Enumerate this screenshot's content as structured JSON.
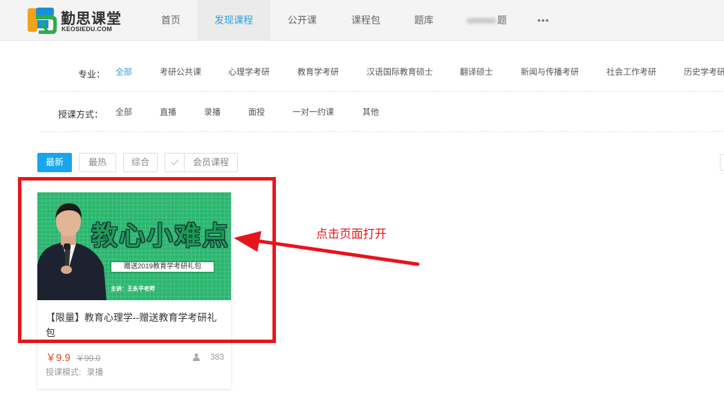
{
  "header": {
    "logo_text": "勤思课堂",
    "logo_sub": "KEOSIEDU.COM",
    "nav": [
      {
        "label": "首页",
        "active": false
      },
      {
        "label": "发现课程",
        "active": true
      },
      {
        "label": "公开课",
        "active": false
      },
      {
        "label": "课程包",
        "active": false
      },
      {
        "label": "题库",
        "active": false
      },
      {
        "label": "题",
        "active": false,
        "blurred": true
      }
    ],
    "more": "•••"
  },
  "filters": {
    "major": {
      "label": "专业：",
      "items": [
        "全部",
        "考研公共课",
        "心理学考研",
        "教育学考研",
        "汉语国际教育硕士",
        "翻译硕士",
        "新闻与传播考研",
        "社会工作考研",
        "历史学考研"
      ],
      "selected": 0
    },
    "mode": {
      "label": "授课方式：",
      "items": [
        "全部",
        "直播",
        "录播",
        "面授",
        "一对一约课",
        "其他"
      ],
      "selected": -1
    }
  },
  "sort_tabs": {
    "items": [
      "最新",
      "最热",
      "综合"
    ],
    "selected": 0,
    "member_label": "会员课程"
  },
  "course": {
    "thumb": {
      "title": "教心小难点",
      "banner": "赠送2019教育学考研礼包",
      "lecturer": "主讲：王永平老师"
    },
    "title": "【限量】教育心理学--赠送教育学考研礼包",
    "price": "￥9.9",
    "price_old": "￥99.0",
    "learners": "383",
    "mode_label": "授课模式:",
    "mode_value": "录播"
  },
  "annotation": {
    "text": "点击页面打开",
    "color": "#e8141b"
  },
  "colors": {
    "accent": "#19a5ec",
    "price": "#e8411f",
    "thumb_green": "#2bb66f"
  }
}
